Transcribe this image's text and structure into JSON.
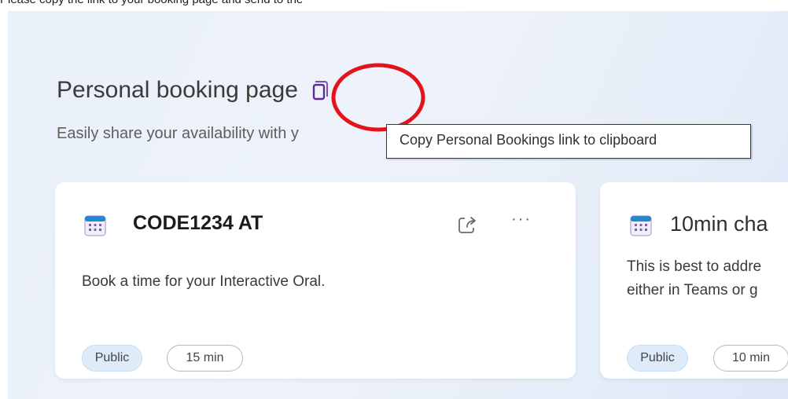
{
  "top_text": "Please copy the link to your booking page and send to the",
  "heading": {
    "title": "Personal booking page"
  },
  "subtitle": "Easily share your availability with y",
  "tooltip": "Copy Personal Bookings link to clipboard",
  "cards": [
    {
      "title": "CODE1234 AT",
      "description": [
        "Book a time for your Interactive Oral."
      ],
      "visibility": "Public",
      "duration": "15 min",
      "icon": "calendar-icon"
    },
    {
      "title": "10min cha",
      "description": [
        "This is best to addre",
        "either in Teams or g"
      ],
      "visibility": "Public",
      "duration": "10 min",
      "icon": "calendar-icon"
    }
  ],
  "colors": {
    "annotation_circle": "#e3121b",
    "accent": "#5c2e91",
    "public_pill": "#deecf9"
  }
}
